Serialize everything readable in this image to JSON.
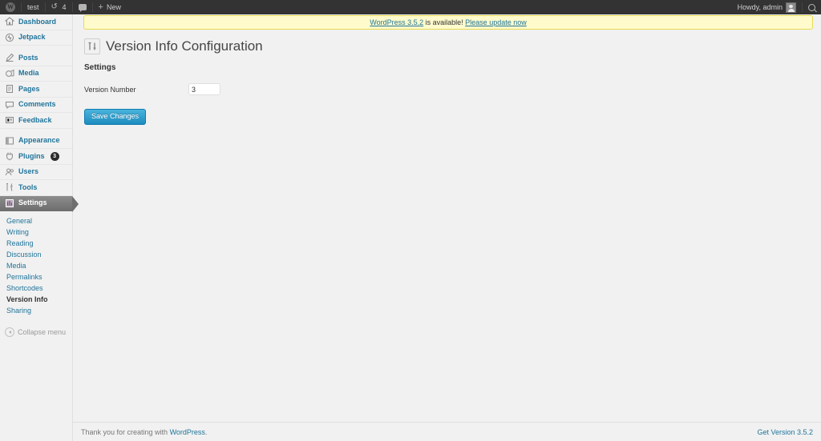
{
  "adminbar": {
    "logo_icon": "wordpress-logo-icon",
    "site_name": "test",
    "updates_icon": "updates-icon",
    "updates_count": "4",
    "comments_icon": "comments-icon",
    "new_icon": "plus-icon",
    "new_label": "New",
    "howdy": "Howdy, admin",
    "avatar_icon": "avatar-icon",
    "search_icon": "search-icon"
  },
  "sidebar": {
    "items": [
      {
        "label": "Dashboard",
        "icon": "dashboard-icon",
        "badge": null,
        "current": false
      },
      {
        "label": "Jetpack",
        "icon": "jetpack-icon",
        "badge": null,
        "current": false
      },
      {
        "label": "Posts",
        "icon": "posts-icon",
        "badge": null,
        "current": false
      },
      {
        "label": "Media",
        "icon": "media-icon",
        "badge": null,
        "current": false
      },
      {
        "label": "Pages",
        "icon": "pages-icon",
        "badge": null,
        "current": false
      },
      {
        "label": "Comments",
        "icon": "comments-icon",
        "badge": null,
        "current": false
      },
      {
        "label": "Feedback",
        "icon": "feedback-icon",
        "badge": null,
        "current": false
      },
      {
        "label": "Appearance",
        "icon": "appearance-icon",
        "badge": null,
        "current": false
      },
      {
        "label": "Plugins",
        "icon": "plugins-icon",
        "badge": "3",
        "current": false
      },
      {
        "label": "Users",
        "icon": "users-icon",
        "badge": null,
        "current": false
      },
      {
        "label": "Tools",
        "icon": "tools-icon",
        "badge": null,
        "current": false
      },
      {
        "label": "Settings",
        "icon": "settings-icon",
        "badge": null,
        "current": true
      }
    ],
    "submenu": [
      {
        "label": "General",
        "current": false
      },
      {
        "label": "Writing",
        "current": false
      },
      {
        "label": "Reading",
        "current": false
      },
      {
        "label": "Discussion",
        "current": false
      },
      {
        "label": "Media",
        "current": false
      },
      {
        "label": "Permalinks",
        "current": false
      },
      {
        "label": "Shortcodes",
        "current": false
      },
      {
        "label": "Version Info",
        "current": true
      },
      {
        "label": "Sharing",
        "current": false
      }
    ],
    "collapse_label": "Collapse menu",
    "collapse_icon": "collapse-arrow-icon"
  },
  "notice": {
    "link_version": "WordPress 3.5.2",
    "middle_text": " is available! ",
    "link_update": "Please update now"
  },
  "page": {
    "icon": "settings-sliders-icon",
    "title": "Version Info Configuration",
    "section_heading": "Settings"
  },
  "form": {
    "version_number_label": "Version Number",
    "version_number_value": "3",
    "version_number_placeholder": "",
    "save_label": "Save Changes"
  },
  "footer": {
    "thanks_prefix": "Thank you for creating with ",
    "thanks_link": "WordPress",
    "thanks_suffix": ".",
    "version_link": "Get Version 3.5.2"
  },
  "colors": {
    "adminbar_bg": "#333333",
    "accent_link": "#21759b",
    "notice_bg": "#fffbcc",
    "notice_border": "#e6db55",
    "button_blue": "#2ea2cc",
    "current_menu_bg": "#777777"
  }
}
